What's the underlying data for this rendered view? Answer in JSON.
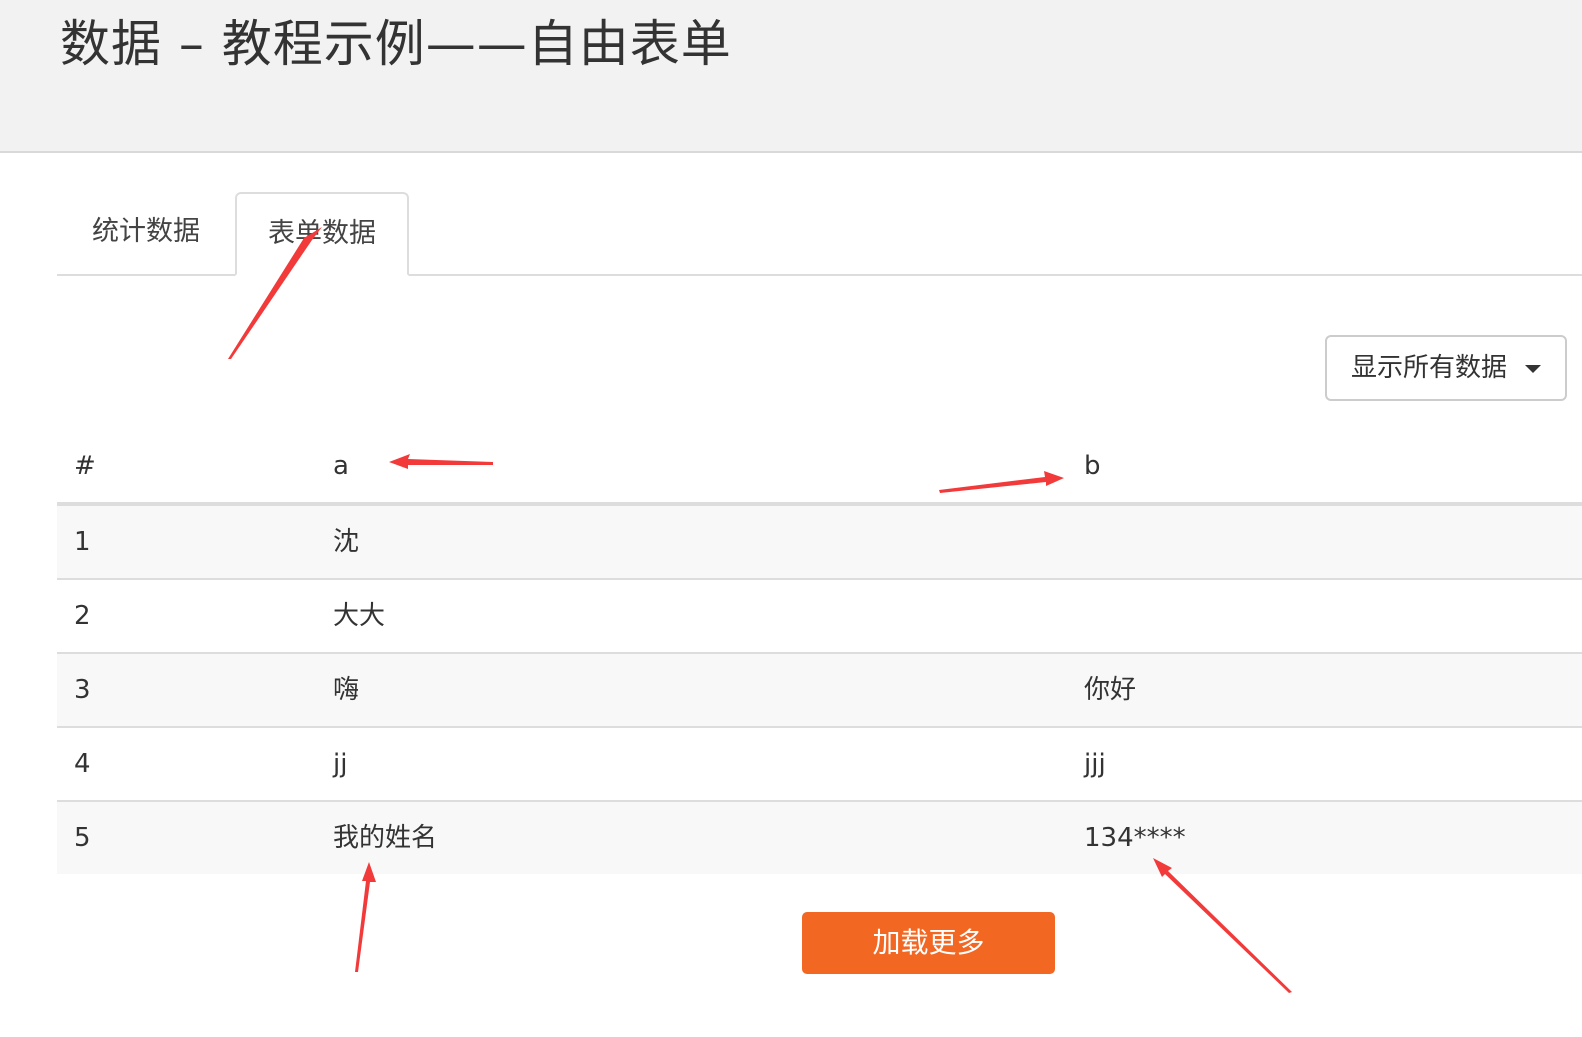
{
  "header": {
    "title": "数据 – 教程示例——自由表单"
  },
  "tabs": [
    {
      "label": "统计数据",
      "active": false
    },
    {
      "label": "表单数据",
      "active": true
    }
  ],
  "filter": {
    "selected": "显示所有数据"
  },
  "table": {
    "columns": [
      "#",
      "a",
      "b"
    ],
    "rows": [
      [
        "1",
        "沈",
        ""
      ],
      [
        "2",
        "大大",
        ""
      ],
      [
        "3",
        "嗨",
        "你好"
      ],
      [
        "4",
        "jj",
        "jjj"
      ],
      [
        "5",
        "我的姓名",
        "134****"
      ]
    ]
  },
  "load_more": {
    "label": "加载更多"
  },
  "colors": {
    "accent": "#f26722",
    "annotation_arrow": "#f23a3a",
    "header_bg": "#f2f2f2"
  }
}
